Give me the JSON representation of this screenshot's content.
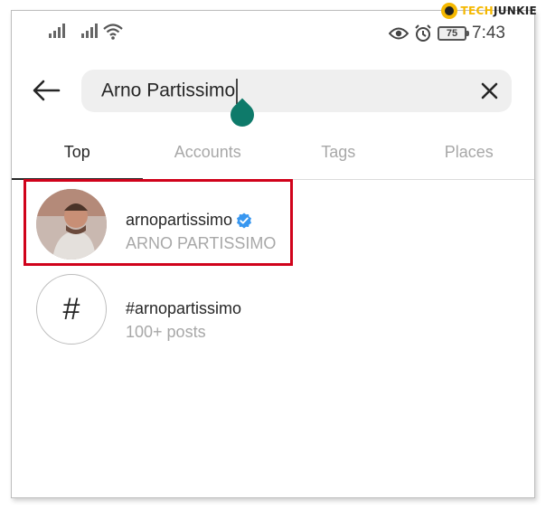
{
  "watermark": {
    "part_a": "TECH",
    "part_b": "JUNKIE"
  },
  "status_bar": {
    "battery": "75",
    "time": "7:43"
  },
  "search": {
    "query": "Arno Partissimo"
  },
  "tabs": [
    {
      "label": "Top"
    },
    {
      "label": "Accounts"
    },
    {
      "label": "Tags"
    },
    {
      "label": "Places"
    }
  ],
  "results": [
    {
      "title": "arnopartissimo",
      "subtitle": "ARNO PARTISSIMO",
      "verified": true
    },
    {
      "title": "#arnopartissimo",
      "subtitle": "100+ posts",
      "icon_symbol": "#"
    }
  ],
  "colors": {
    "highlight": "#d0021b",
    "verified": "#3897f0",
    "cursor": "#0e7a6a"
  }
}
